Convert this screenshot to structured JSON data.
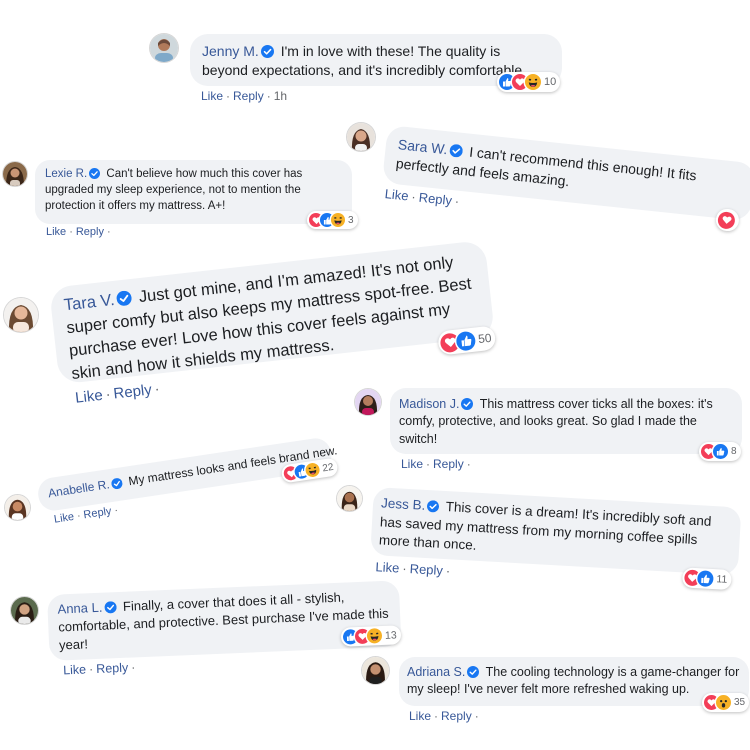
{
  "colors": {
    "bubble": "#f0f2f5",
    "name": "#385898",
    "like_blue": "#1877f2",
    "love_red": "#f33e58",
    "haha_yellow": "#f7b125",
    "verified": "#1877f2"
  },
  "actions": {
    "like": "Like",
    "reply": "Reply",
    "separator": "·"
  },
  "comments": [
    {
      "name": "Jenny M.",
      "text": "I'm in love with these! The quality is beyond expectations, and it's incredibly comfortable.",
      "time": "1h",
      "reactions": [
        "like-reaction-icon",
        "love-reaction-icon",
        "haha-reaction-icon"
      ],
      "count": "10"
    },
    {
      "name": "Sara W.",
      "text": "I can't recommend this enough! It fits perfectly and feels amazing.",
      "reactions": [
        "love-reaction-icon"
      ]
    },
    {
      "name": "Lexie R.",
      "text": "Can't believe how much this cover has upgraded my sleep experience, not to mention the protection it offers my mattress. A+!",
      "reactions": [
        "love-reaction-icon",
        "like-reaction-icon",
        "haha-reaction-icon"
      ],
      "count": "3"
    },
    {
      "name": "Tara V.",
      "text": "Just got mine, and I'm amazed! It's not only super comfy but also keeps my mattress spot-free. Best purchase ever! Love how this cover feels against my skin and how it shields my mattress.",
      "reactions": [
        "love-reaction-icon",
        "like-reaction-icon"
      ],
      "count": "50"
    },
    {
      "name": "Madison J.",
      "text": "This mattress cover ticks all the boxes: it's comfy, protective, and looks great. So glad I made the switch!",
      "reactions": [
        "love-reaction-icon",
        "like-reaction-icon"
      ],
      "count": "8"
    },
    {
      "name": "Anabelle R.",
      "text": "My mattress looks and feels brand new.",
      "reactions": [
        "love-reaction-icon",
        "like-reaction-icon",
        "haha-reaction-icon"
      ],
      "count": "22"
    },
    {
      "name": "Jess B.",
      "text": "This cover is a dream! It's incredibly soft and has saved my mattress from my morning coffee spills more than once.",
      "reactions": [
        "love-reaction-icon",
        "like-reaction-icon"
      ],
      "count": "11"
    },
    {
      "name": "Anna L.",
      "text": "Finally, a cover that does it all - stylish, comfortable, and protective. Best purchase I've made this year!",
      "reactions": [
        "like-reaction-icon",
        "love-reaction-icon",
        "haha-reaction-icon"
      ],
      "count": "13"
    },
    {
      "name": "Adriana S.",
      "text": "The cooling technology is a game-changer for my sleep! I've never felt more refreshed waking up.",
      "reactions": [
        "love-reaction-icon",
        "wow-reaction-icon"
      ],
      "count": "35"
    }
  ]
}
